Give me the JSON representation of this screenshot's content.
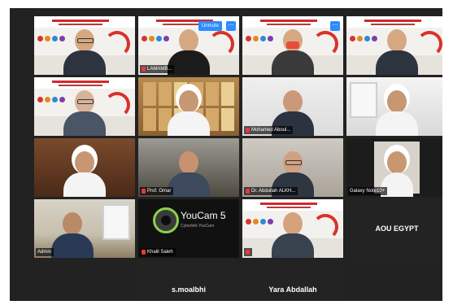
{
  "gallery": {
    "tiles": [
      {
        "id": "t1",
        "label": "",
        "kind": "presentation"
      },
      {
        "id": "t2",
        "label": "LAMAMB...",
        "kind": "presentation",
        "overlay_button": "Unmute"
      },
      {
        "id": "t3",
        "label": "",
        "kind": "presentation",
        "active": true
      },
      {
        "id": "t4",
        "label": "",
        "kind": "presentation"
      },
      {
        "id": "t5",
        "label": "",
        "kind": "presentation"
      },
      {
        "id": "t6",
        "label": "",
        "kind": "camera"
      },
      {
        "id": "t7",
        "label": "Mohamed Aboul...",
        "kind": "camera"
      },
      {
        "id": "t8",
        "label": "",
        "kind": "camera"
      },
      {
        "id": "t9",
        "label": "",
        "kind": "camera"
      },
      {
        "id": "t10",
        "label": "Prof. Omar",
        "kind": "camera"
      },
      {
        "id": "t11",
        "label": "Dr. Abdullah ALKH...",
        "kind": "camera"
      },
      {
        "id": "t12",
        "label": "Galaxy Note10+",
        "kind": "camera"
      },
      {
        "id": "t13",
        "label": "Admin",
        "kind": "camera"
      },
      {
        "id": "t14",
        "label": "Khalil Saleh",
        "kind": "youcam",
        "brand": "YouCam 5",
        "brand_sub": "Cyberlink YouCam"
      },
      {
        "id": "t15",
        "label": "",
        "kind": "presentation"
      },
      {
        "id": "t16",
        "label": "AOU EGYPT",
        "kind": "name-only"
      },
      {
        "id": "t17",
        "label": "s.moalbhi",
        "kind": "name-only"
      },
      {
        "id": "t18",
        "label": "Yara Abdallah",
        "kind": "name-only"
      }
    ]
  },
  "colors": {
    "background": "#222222",
    "active_border": "#3ec84a",
    "button_blue": "#2d8cff",
    "muted_mic": "#e23b3b"
  }
}
